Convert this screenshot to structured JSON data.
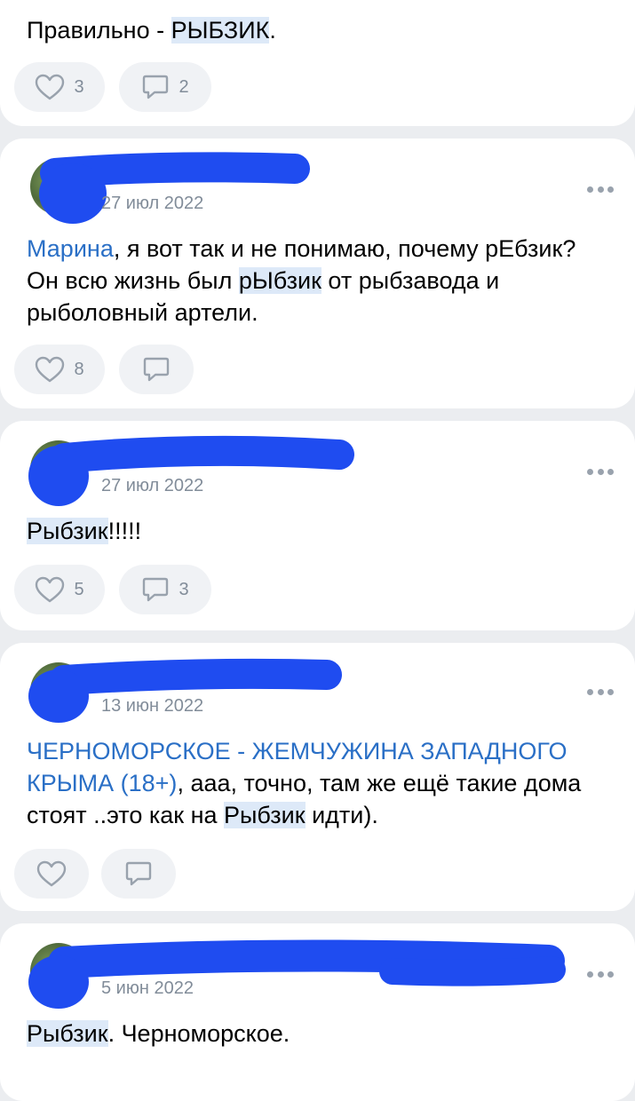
{
  "colors": {
    "background": "#ebedf0",
    "card": "#ffffff",
    "mention": "#2a6fc6",
    "highlight": "#dde9f8",
    "meta": "#818c99",
    "redaction": "#1f4cf0"
  },
  "comments": [
    {
      "text_parts": [
        "Правильно - ",
        "РЫБЗИК",
        "."
      ],
      "likes": "3",
      "replies": "2"
    },
    {
      "date": "27 июл 2022",
      "mention": "Марина",
      "text_parts": [
        ", я вот так и не понимаю, почему рЕбзик? Он всю жизнь был ",
        "рЫбзик",
        " от рыбзавода и рыболовный артели."
      ],
      "likes": "8",
      "replies": ""
    },
    {
      "date": "27 июл 2022",
      "text_parts": [
        "Рыбзик",
        "!!!!!"
      ],
      "likes": "5",
      "replies": "3"
    },
    {
      "date": "13 июн 2022",
      "mention": "ЧЕРНОМОРСКОЕ - ЖЕМЧУЖИНА ЗАПАДНОГО КРЫМА (18+)",
      "text_parts": [
        ", ааа, точно, там же ещё такие дома стоят ..это как на ",
        "Рыбзик",
        " идти)."
      ],
      "likes": "",
      "replies": ""
    },
    {
      "date": "5 июн 2022",
      "text_parts": [
        "Рыбзик",
        ". Черноморское."
      ]
    }
  ],
  "icons": {
    "like": "heart-icon",
    "reply": "comment-icon",
    "more": "more-dots-icon"
  }
}
